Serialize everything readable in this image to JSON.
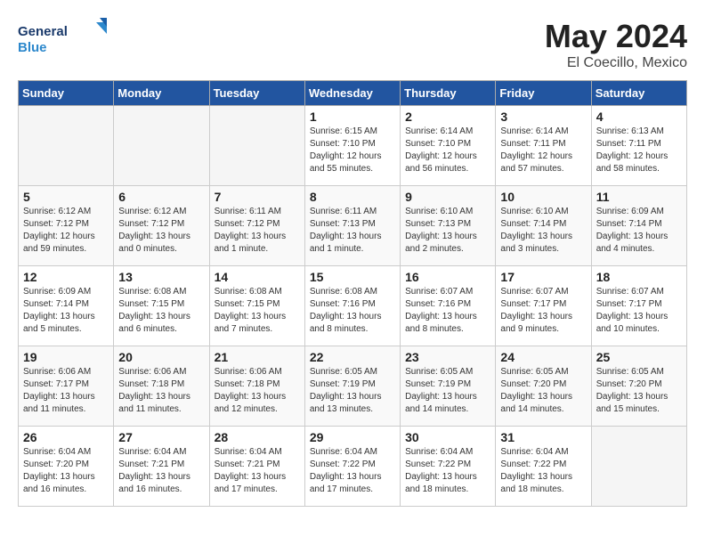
{
  "logo": {
    "line1": "General",
    "line2": "Blue"
  },
  "title": "May 2024",
  "location": "El Coecillo, Mexico",
  "days_header": [
    "Sunday",
    "Monday",
    "Tuesday",
    "Wednesday",
    "Thursday",
    "Friday",
    "Saturday"
  ],
  "weeks": [
    [
      {
        "num": "",
        "sunrise": "",
        "sunset": "",
        "daylight": ""
      },
      {
        "num": "",
        "sunrise": "",
        "sunset": "",
        "daylight": ""
      },
      {
        "num": "",
        "sunrise": "",
        "sunset": "",
        "daylight": ""
      },
      {
        "num": "1",
        "sunrise": "Sunrise: 6:15 AM",
        "sunset": "Sunset: 7:10 PM",
        "daylight": "Daylight: 12 hours and 55 minutes."
      },
      {
        "num": "2",
        "sunrise": "Sunrise: 6:14 AM",
        "sunset": "Sunset: 7:10 PM",
        "daylight": "Daylight: 12 hours and 56 minutes."
      },
      {
        "num": "3",
        "sunrise": "Sunrise: 6:14 AM",
        "sunset": "Sunset: 7:11 PM",
        "daylight": "Daylight: 12 hours and 57 minutes."
      },
      {
        "num": "4",
        "sunrise": "Sunrise: 6:13 AM",
        "sunset": "Sunset: 7:11 PM",
        "daylight": "Daylight: 12 hours and 58 minutes."
      }
    ],
    [
      {
        "num": "5",
        "sunrise": "Sunrise: 6:12 AM",
        "sunset": "Sunset: 7:12 PM",
        "daylight": "Daylight: 12 hours and 59 minutes."
      },
      {
        "num": "6",
        "sunrise": "Sunrise: 6:12 AM",
        "sunset": "Sunset: 7:12 PM",
        "daylight": "Daylight: 13 hours and 0 minutes."
      },
      {
        "num": "7",
        "sunrise": "Sunrise: 6:11 AM",
        "sunset": "Sunset: 7:12 PM",
        "daylight": "Daylight: 13 hours and 1 minute."
      },
      {
        "num": "8",
        "sunrise": "Sunrise: 6:11 AM",
        "sunset": "Sunset: 7:13 PM",
        "daylight": "Daylight: 13 hours and 1 minute."
      },
      {
        "num": "9",
        "sunrise": "Sunrise: 6:10 AM",
        "sunset": "Sunset: 7:13 PM",
        "daylight": "Daylight: 13 hours and 2 minutes."
      },
      {
        "num": "10",
        "sunrise": "Sunrise: 6:10 AM",
        "sunset": "Sunset: 7:14 PM",
        "daylight": "Daylight: 13 hours and 3 minutes."
      },
      {
        "num": "11",
        "sunrise": "Sunrise: 6:09 AM",
        "sunset": "Sunset: 7:14 PM",
        "daylight": "Daylight: 13 hours and 4 minutes."
      }
    ],
    [
      {
        "num": "12",
        "sunrise": "Sunrise: 6:09 AM",
        "sunset": "Sunset: 7:14 PM",
        "daylight": "Daylight: 13 hours and 5 minutes."
      },
      {
        "num": "13",
        "sunrise": "Sunrise: 6:08 AM",
        "sunset": "Sunset: 7:15 PM",
        "daylight": "Daylight: 13 hours and 6 minutes."
      },
      {
        "num": "14",
        "sunrise": "Sunrise: 6:08 AM",
        "sunset": "Sunset: 7:15 PM",
        "daylight": "Daylight: 13 hours and 7 minutes."
      },
      {
        "num": "15",
        "sunrise": "Sunrise: 6:08 AM",
        "sunset": "Sunset: 7:16 PM",
        "daylight": "Daylight: 13 hours and 8 minutes."
      },
      {
        "num": "16",
        "sunrise": "Sunrise: 6:07 AM",
        "sunset": "Sunset: 7:16 PM",
        "daylight": "Daylight: 13 hours and 8 minutes."
      },
      {
        "num": "17",
        "sunrise": "Sunrise: 6:07 AM",
        "sunset": "Sunset: 7:17 PM",
        "daylight": "Daylight: 13 hours and 9 minutes."
      },
      {
        "num": "18",
        "sunrise": "Sunrise: 6:07 AM",
        "sunset": "Sunset: 7:17 PM",
        "daylight": "Daylight: 13 hours and 10 minutes."
      }
    ],
    [
      {
        "num": "19",
        "sunrise": "Sunrise: 6:06 AM",
        "sunset": "Sunset: 7:17 PM",
        "daylight": "Daylight: 13 hours and 11 minutes."
      },
      {
        "num": "20",
        "sunrise": "Sunrise: 6:06 AM",
        "sunset": "Sunset: 7:18 PM",
        "daylight": "Daylight: 13 hours and 11 minutes."
      },
      {
        "num": "21",
        "sunrise": "Sunrise: 6:06 AM",
        "sunset": "Sunset: 7:18 PM",
        "daylight": "Daylight: 13 hours and 12 minutes."
      },
      {
        "num": "22",
        "sunrise": "Sunrise: 6:05 AM",
        "sunset": "Sunset: 7:19 PM",
        "daylight": "Daylight: 13 hours and 13 minutes."
      },
      {
        "num": "23",
        "sunrise": "Sunrise: 6:05 AM",
        "sunset": "Sunset: 7:19 PM",
        "daylight": "Daylight: 13 hours and 14 minutes."
      },
      {
        "num": "24",
        "sunrise": "Sunrise: 6:05 AM",
        "sunset": "Sunset: 7:20 PM",
        "daylight": "Daylight: 13 hours and 14 minutes."
      },
      {
        "num": "25",
        "sunrise": "Sunrise: 6:05 AM",
        "sunset": "Sunset: 7:20 PM",
        "daylight": "Daylight: 13 hours and 15 minutes."
      }
    ],
    [
      {
        "num": "26",
        "sunrise": "Sunrise: 6:04 AM",
        "sunset": "Sunset: 7:20 PM",
        "daylight": "Daylight: 13 hours and 16 minutes."
      },
      {
        "num": "27",
        "sunrise": "Sunrise: 6:04 AM",
        "sunset": "Sunset: 7:21 PM",
        "daylight": "Daylight: 13 hours and 16 minutes."
      },
      {
        "num": "28",
        "sunrise": "Sunrise: 6:04 AM",
        "sunset": "Sunset: 7:21 PM",
        "daylight": "Daylight: 13 hours and 17 minutes."
      },
      {
        "num": "29",
        "sunrise": "Sunrise: 6:04 AM",
        "sunset": "Sunset: 7:22 PM",
        "daylight": "Daylight: 13 hours and 17 minutes."
      },
      {
        "num": "30",
        "sunrise": "Sunrise: 6:04 AM",
        "sunset": "Sunset: 7:22 PM",
        "daylight": "Daylight: 13 hours and 18 minutes."
      },
      {
        "num": "31",
        "sunrise": "Sunrise: 6:04 AM",
        "sunset": "Sunset: 7:22 PM",
        "daylight": "Daylight: 13 hours and 18 minutes."
      },
      {
        "num": "",
        "sunrise": "",
        "sunset": "",
        "daylight": ""
      }
    ]
  ]
}
